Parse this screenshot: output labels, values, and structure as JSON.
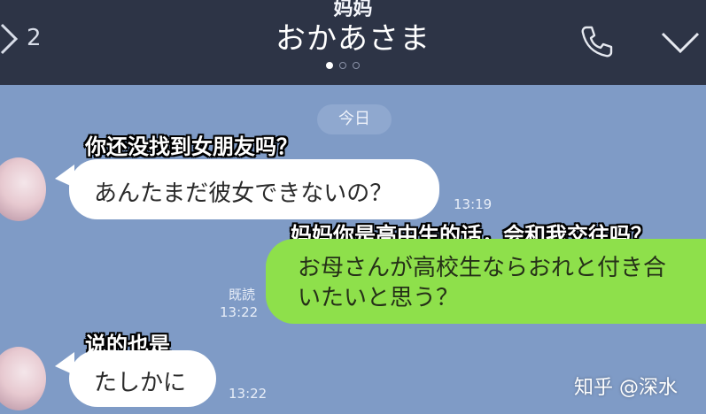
{
  "header": {
    "back_count": "2",
    "subtitle": "妈妈",
    "title": "おかあさま",
    "page_dots": 3,
    "active_dot": 0
  },
  "chat": {
    "day_label": "今日",
    "messages": [
      {
        "caption": "你还没找到女朋友吗？",
        "text": "あんたまだ彼女できないの？",
        "time": "13:19"
      },
      {
        "caption": "妈妈你是高中生的话，会和我交往吗？",
        "text_line1": "お母さんが高校生ならおれと付き合",
        "text_line2": "いたいと思う？",
        "read": "既読",
        "time": "13:22"
      },
      {
        "caption": "说的也是",
        "text": "たしかに",
        "time": "13:22"
      }
    ]
  },
  "watermark": "知乎 @深水",
  "colors": {
    "header_bg": "#2d3446",
    "chat_bg": "#7f9bc6",
    "incoming_bubble": "#ffffff",
    "outgoing_bubble": "#8ee04b"
  },
  "icons": [
    "back-arrow-icon",
    "phone-icon",
    "chevron-down-icon"
  ]
}
